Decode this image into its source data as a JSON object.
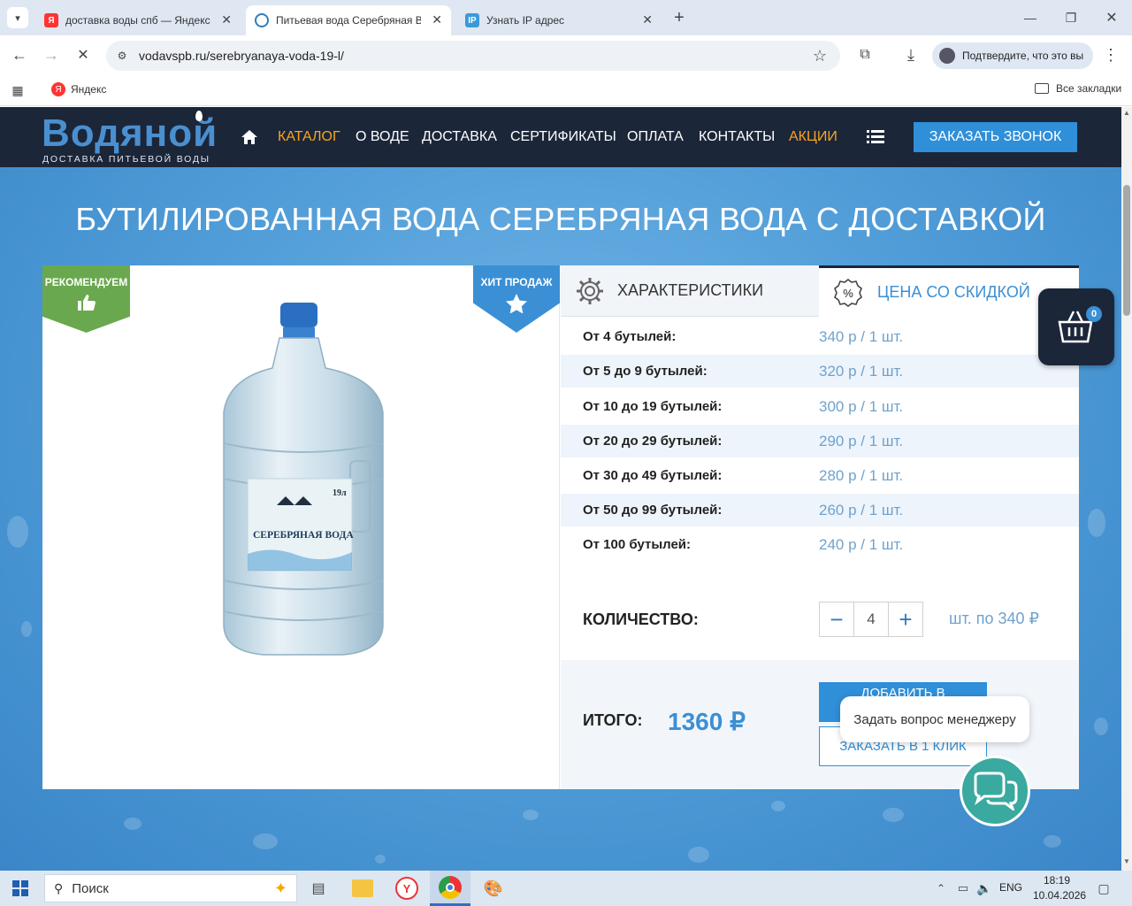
{
  "browser": {
    "tabs": [
      {
        "title": "доставка воды спб — Яндекс"
      },
      {
        "title": "Питьевая вода Серебряная Во"
      },
      {
        "title": "Узнать IP адрес"
      }
    ],
    "url": "vodavspb.ru/serebryanaya-voda-19-l/",
    "profile_button": "Подтвердите, что это вы",
    "bookmarks": {
      "yandex": "Яндекс",
      "all": "Все закладки"
    }
  },
  "site": {
    "logo": "Водяной",
    "logo_sub": "ДОСТАВКА ПИТЬЕВОЙ ВОДЫ",
    "nav": [
      "КАТАЛОГ",
      "О ВОДЕ",
      "ДОСТАВКА",
      "СЕРТИФИКАТЫ",
      "ОПЛАТА",
      "КОНТАКТЫ",
      "АКЦИИ"
    ],
    "call_button": "ЗАКАЗАТЬ ЗВОНОК"
  },
  "product": {
    "heading": "БУТИЛИРОВАННАЯ ВОДА СЕРЕБРЯНАЯ ВОДА С ДОСТАВКОЙ",
    "badge_left": "РЕКОМЕНДУЕМ",
    "badge_right": "ХИТ ПРОДАЖ",
    "bottle_label": "СЕРЕБРЯНАЯ ВОДА",
    "bottle_volume": "19л",
    "tabs": {
      "characteristics": "ХАРАКТЕРИСТИКИ",
      "discount": "ЦЕНА СО СКИДКОЙ"
    },
    "prices": [
      {
        "label": "От 4 бутылей:",
        "value": "340 р / 1 шт."
      },
      {
        "label": "От 5 до 9 бутылей:",
        "value": "320 р / 1 шт."
      },
      {
        "label": "От 10 до 19 бутылей:",
        "value": "300 р / 1 шт."
      },
      {
        "label": "От 20 до 29 бутылей:",
        "value": "290 р / 1 шт."
      },
      {
        "label": "От 30 до 49 бутылей:",
        "value": "280 р / 1 шт."
      },
      {
        "label": "От 50 до 99 бутылей:",
        "value": "260 р / 1 шт."
      },
      {
        "label": "От 100 бутылей:",
        "value": "240 р / 1 шт."
      }
    ],
    "quantity_label": "КОЛИЧЕСТВО:",
    "quantity": "4",
    "unit_price": "шт. по 340 ₽",
    "total_label": "ИТОГО:",
    "total": "1360 ₽",
    "add_button": "ДОБАВИТЬ В",
    "one_click_button": "ЗАКАЗАТЬ В 1 КЛИК"
  },
  "cart": {
    "count": "0"
  },
  "chat": {
    "tooltip": "Задать вопрос менеджеру"
  },
  "taskbar": {
    "search": "Поиск",
    "lang": "ENG",
    "time": "18:19",
    "date": "10.04.2026"
  },
  "colors": {
    "navy": "#1c2639",
    "accent": "#2f8fd8",
    "orange": "#f8a520",
    "green": "#6aa84f",
    "teal": "#3aa99f"
  }
}
